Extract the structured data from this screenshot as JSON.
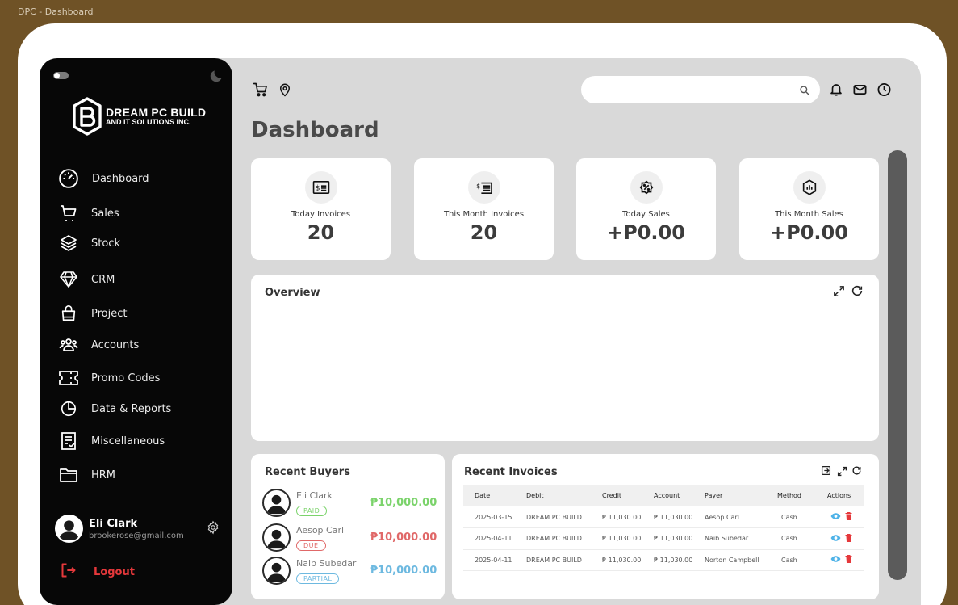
{
  "window": {
    "title": "DPC - Dashboard"
  },
  "brand": {
    "line1": "DREAM PC BUILD",
    "line2": "AND IT SOLUTIONS INC."
  },
  "sidebar": {
    "items": [
      {
        "label": "Dashboard",
        "icon": "gauge-icon"
      },
      {
        "label": "Sales",
        "icon": "cart-icon"
      },
      {
        "label": "Stock",
        "icon": "layers-icon"
      },
      {
        "label": "CRM",
        "icon": "diamond-icon"
      },
      {
        "label": "Project",
        "icon": "bag-icon"
      },
      {
        "label": "Accounts",
        "icon": "users-icon"
      },
      {
        "label": "Promo Codes",
        "icon": "ticket-icon"
      },
      {
        "label": "Data & Reports",
        "icon": "pie-chart-icon"
      },
      {
        "label": "Miscellaneous",
        "icon": "checklist-icon"
      },
      {
        "label": "HRM",
        "icon": "folder-icon"
      }
    ],
    "user": {
      "name": "Eli Clark",
      "email": "brookerose@gmail.com"
    },
    "logout_label": "Logout"
  },
  "header": {
    "search_placeholder": "",
    "page_title": "Dashboard"
  },
  "stats": [
    {
      "label": "Today Invoices",
      "value": "20",
      "icon": "invoice-icon"
    },
    {
      "label": "This Month Invoices",
      "value": "20",
      "icon": "invoice-list-icon"
    },
    {
      "label": "Today Sales",
      "value": "+P0.00",
      "icon": "percent-badge-icon"
    },
    {
      "label": "This Month Sales",
      "value": "+P0.00",
      "icon": "chart-badge-icon"
    }
  ],
  "overview": {
    "title": "Overview"
  },
  "recent_buyers": {
    "title": "Recent Buyers",
    "items": [
      {
        "name": "Eli Clark",
        "status": "PAID",
        "amount": "₱10,000.00",
        "color": "#7bd36b"
      },
      {
        "name": "Aesop Carl",
        "status": "DUE",
        "amount": "₱10,000.00",
        "color": "#e06868"
      },
      {
        "name": "Naib Subedar",
        "status": "PARTIAL",
        "amount": "₱10,000.00",
        "color": "#6db9e0"
      }
    ]
  },
  "recent_invoices": {
    "title": "Recent Invoices",
    "columns": [
      "Date",
      "Debit",
      "Credit",
      "Account",
      "Payer",
      "Method",
      "Actions"
    ],
    "rows": [
      [
        "2025-03-15",
        "DREAM PC BUILD",
        "₱ 11,030.00",
        "₱ 11,030.00",
        "Aesop Carl",
        "Cash"
      ],
      [
        "2025-04-11",
        "DREAM PC BUILD",
        "₱ 11,030.00",
        "₱ 11,030.00",
        "Naib Subedar",
        "Cash"
      ],
      [
        "2025-04-11",
        "DREAM PC BUILD",
        "₱ 11,030.00",
        "₱ 11,030.00",
        "Norton Campbell",
        "Cash"
      ]
    ]
  },
  "colors": {
    "sidebar": "#070707",
    "main": "#d9d9d9",
    "accent_red": "#e5383b",
    "view": "#4fb3e8",
    "delete": "#e5383b"
  }
}
